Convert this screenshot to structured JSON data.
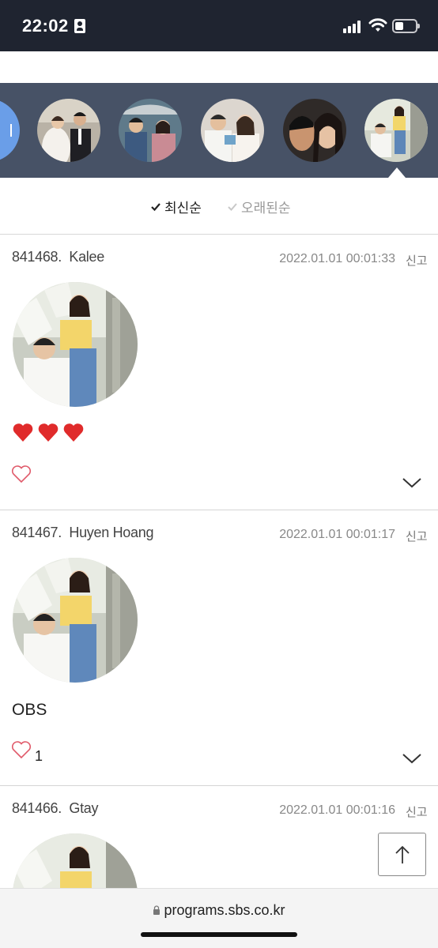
{
  "status_bar": {
    "time": "22:02",
    "icons": [
      "id-card-icon",
      "signal-icon",
      "wifi-icon",
      "battery-icon"
    ]
  },
  "avatar_strip": {
    "avatars": [
      "couple-wedding-photo",
      "couple-umbrella-photo",
      "couple-white-outfits-photo",
      "couple-close-up-photo",
      "couple-selected-photo"
    ],
    "selected_index": 4
  },
  "sort": {
    "newest_label": "최신순",
    "oldest_label": "오래된순",
    "active": "newest"
  },
  "comments": [
    {
      "id": "841468.",
      "author": "Kalee",
      "date": "2022.01.01 00:01:33",
      "report_label": "신고",
      "text": "",
      "emoji": "❤️❤️❤️",
      "likes": ""
    },
    {
      "id": "841467.",
      "author": "Huyen Hoang",
      "date": "2022.01.01 00:01:17",
      "report_label": "신고",
      "text": "OBS",
      "emoji": "",
      "likes": "1"
    },
    {
      "id": "841466.",
      "author": "Gtay",
      "date": "2022.01.01 00:01:16",
      "report_label": "신고",
      "text": "",
      "emoji": "",
      "likes": ""
    }
  ],
  "browser": {
    "url": "programs.sbs.co.kr"
  },
  "colors": {
    "status_bar_bg": "#1f2430",
    "strip_bg": "#475266",
    "accent_blue": "#6a9ee8",
    "heart_red": "#e02b2b"
  }
}
